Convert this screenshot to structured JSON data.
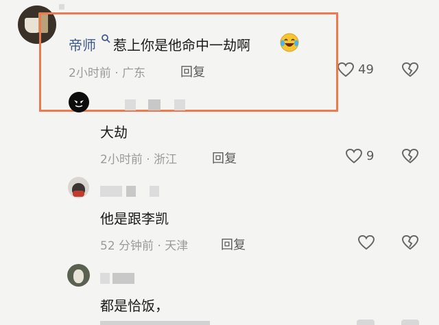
{
  "comments": [
    {
      "name": "帝师",
      "content": "惹上你是他命中一劫啊",
      "time": "2小时前",
      "location": "广东",
      "reply_label": "回复",
      "likes": "49"
    },
    {
      "content": "大劫",
      "time": "2小时前",
      "location": "浙江",
      "reply_label": "回复",
      "likes": "9"
    },
    {
      "content": "他是跟李凯",
      "time": "52 分钟前",
      "location": "天津",
      "reply_label": "回复"
    },
    {
      "content": "都是恰饭，"
    }
  ],
  "colors": {
    "highlight_border": "#ec7a4f",
    "name_blue": "#3d5a8a",
    "meta_gray": "#9a9a9a"
  },
  "icons": {
    "like": "heart-outline-icon",
    "dislike": "broken-heart-icon",
    "emoji": "laughing-tears-emoji",
    "search": "search-icon"
  }
}
